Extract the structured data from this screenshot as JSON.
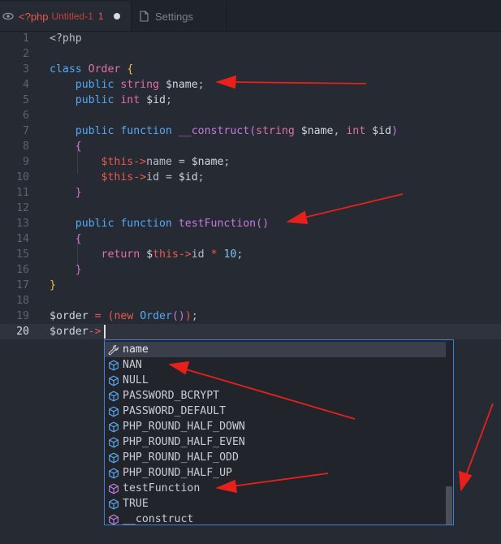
{
  "tabs": [
    {
      "lang": "<?php",
      "name": "Untitled-1",
      "problems": "1"
    },
    {
      "name": "Settings"
    }
  ],
  "code": {
    "line_numbers": [
      "1",
      "2",
      "3",
      "4",
      "5",
      "6",
      "7",
      "8",
      "9",
      "10",
      "11",
      "12",
      "13",
      "14",
      "15",
      "16",
      "17",
      "18",
      "19",
      "20"
    ],
    "current_line": "20"
  },
  "autocomplete": {
    "items": [
      {
        "label": "name",
        "kind": "property"
      },
      {
        "label": "NAN",
        "kind": "constant"
      },
      {
        "label": "NULL",
        "kind": "constant"
      },
      {
        "label": "PASSWORD_BCRYPT",
        "kind": "constant"
      },
      {
        "label": "PASSWORD_DEFAULT",
        "kind": "constant"
      },
      {
        "label": "PHP_ROUND_HALF_DOWN",
        "kind": "constant"
      },
      {
        "label": "PHP_ROUND_HALF_EVEN",
        "kind": "constant"
      },
      {
        "label": "PHP_ROUND_HALF_ODD",
        "kind": "constant"
      },
      {
        "label": "PHP_ROUND_HALF_UP",
        "kind": "constant"
      },
      {
        "label": "testFunction",
        "kind": "method"
      },
      {
        "label": "TRUE",
        "kind": "constant"
      },
      {
        "label": "__construct",
        "kind": "method"
      }
    ]
  },
  "colors": {
    "accent": "#3d80d6",
    "annotation": "#e8201c",
    "error": "#e85a4f"
  }
}
